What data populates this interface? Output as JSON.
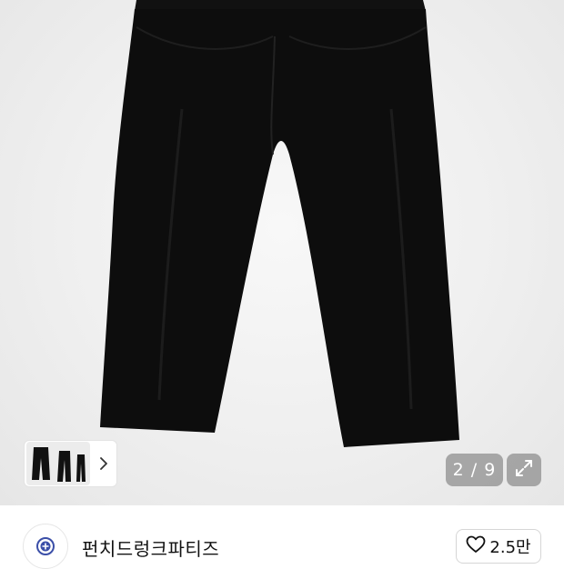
{
  "gallery": {
    "current_index": "2",
    "separator": "/",
    "total": "9",
    "counter_text": "2 / 9"
  },
  "icons": {
    "thumb_next": "chevron-right-icon",
    "expand": "expand-icon",
    "like": "heart-icon"
  },
  "brand": {
    "name": "펀치드렁크파티즈"
  },
  "like": {
    "count": "2.5만"
  },
  "colors": {
    "photo_background": "#efefef",
    "garment": "#0d0d0d",
    "overlay_button": "#8a8a8a",
    "text": "#111111"
  }
}
